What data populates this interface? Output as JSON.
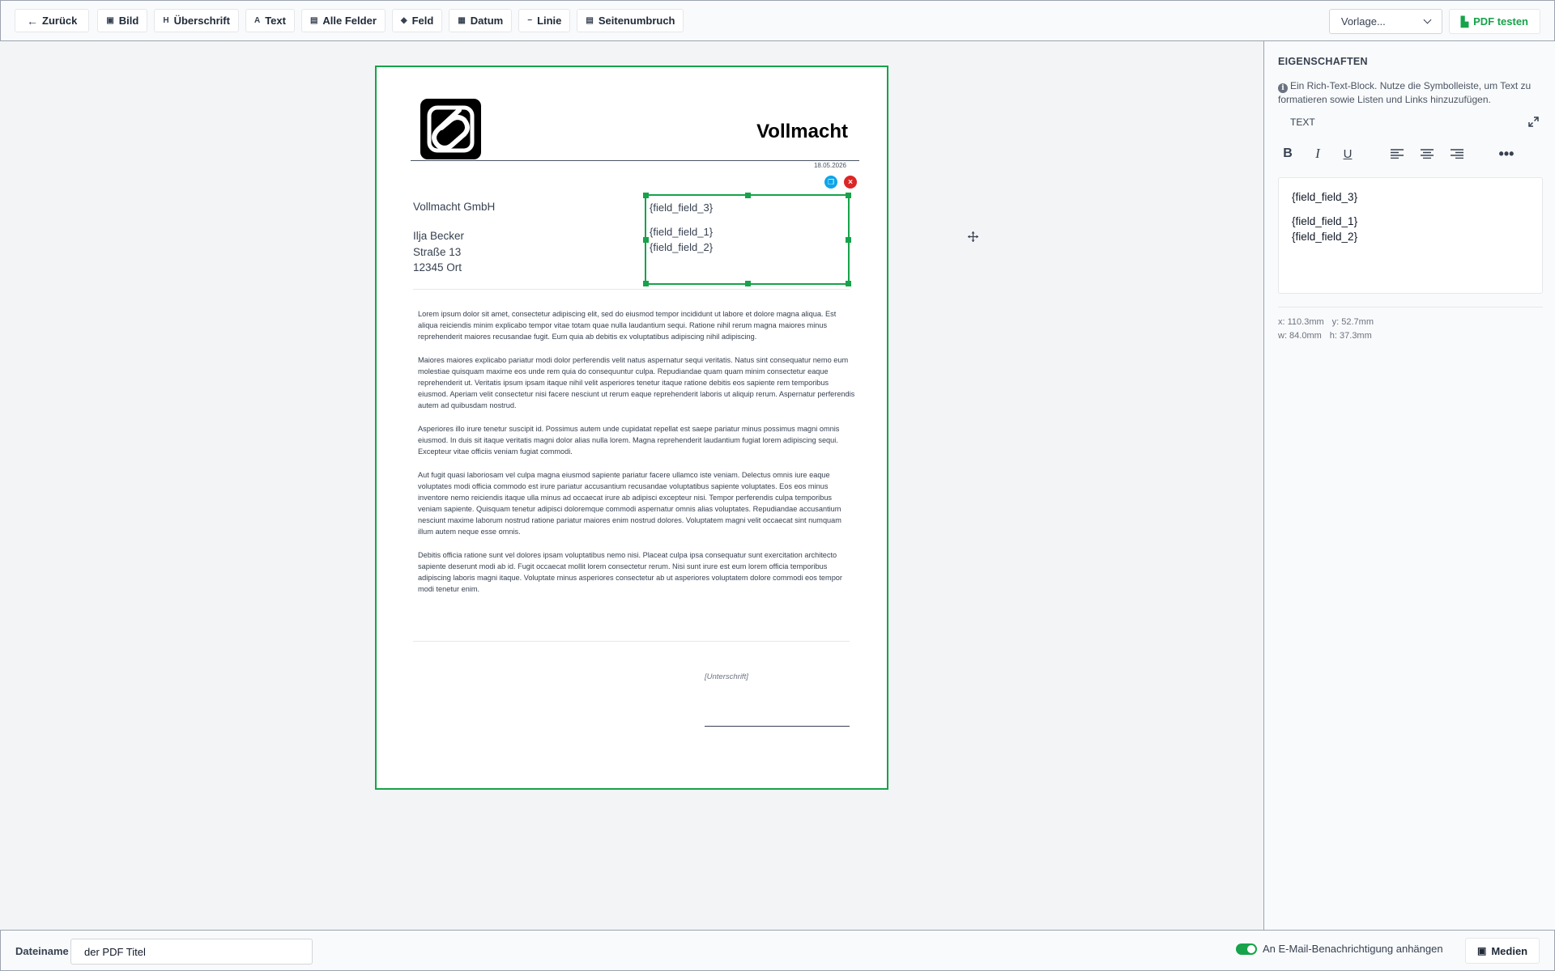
{
  "toolbar": {
    "back_label": "Zurück",
    "buttons": [
      {
        "icon": "image-icon",
        "glyph": "▣",
        "label": "Bild"
      },
      {
        "icon": "heading-icon",
        "glyph": "H",
        "label": "Überschrift"
      },
      {
        "icon": "text-icon",
        "glyph": "A",
        "label": "Text"
      },
      {
        "icon": "all-fields-icon",
        "glyph": "▤",
        "label": "Alle Felder"
      },
      {
        "icon": "field-tag-icon",
        "glyph": "◆",
        "label": "Feld"
      },
      {
        "icon": "calendar-icon",
        "glyph": "▦",
        "label": "Datum"
      },
      {
        "icon": "line-icon",
        "glyph": "−",
        "label": "Linie"
      },
      {
        "icon": "page-break-icon",
        "glyph": "▤",
        "label": "Seitenumbruch"
      }
    ],
    "template_select": "Vorlage...",
    "pdf_test_label": "PDF testen"
  },
  "document": {
    "title": "Vollmacht",
    "date": "18.05.2026",
    "sender": "Vollmacht GmbH",
    "recipient_lines": [
      "Ilja Becker",
      "Straße 13",
      "12345 Ort"
    ],
    "selected_block": {
      "line1": "{field_field_3}",
      "line2": "{field_field_1}",
      "line3": "{field_field_2}"
    },
    "paragraphs": [
      "Lorem ipsum dolor sit amet, consectetur adipiscing elit, sed do eiusmod tempor incididunt ut labore et dolore magna aliqua. Est aliqua reiciendis minim explicabo tempor vitae totam quae nulla laudantium sequi. Ratione nihil rerum magna maiores minus reprehenderit maiores recusandae fugit. Eum quia ab debitis ex voluptatibus adipiscing nihil adipiscing.",
      "Maiores maiores explicabo pariatur modi dolor perferendis velit natus aspernatur sequi veritatis. Natus sint consequatur nemo eum molestiae quisquam maxime eos unde rem quia do consequuntur culpa. Repudiandae quam quam minim consectetur eaque reprehenderit ut. Veritatis ipsum ipsam itaque nihil velit asperiores tenetur itaque ratione debitis eos sapiente rem temporibus eiusmod. Aperiam velit consectetur nisi facere nesciunt ut rerum eaque reprehenderit laboris ut aliquip rerum. Aspernatur perferendis autem ad quibusdam nostrud.",
      "Asperiores illo irure tenetur suscipit id. Possimus autem unde cupidatat repellat est saepe pariatur minus possimus magni omnis eiusmod. In duis sit itaque veritatis magni dolor alias nulla lorem. Magna reprehenderit laudantium fugiat lorem adipiscing sequi. Excepteur vitae officiis veniam fugiat commodi.",
      "Aut fugit quasi laboriosam vel culpa magna eiusmod sapiente pariatur facere ullamco iste veniam. Delectus omnis iure eaque voluptates modi officia commodo est irure pariatur accusantium recusandae voluptatibus sapiente voluptates. Eos eos minus inventore nemo reiciendis itaque ulla minus ad occaecat irure ab adipisci excepteur nisi. Tempor perferendis culpa temporibus veniam sapiente. Quisquam tenetur adipisci doloremque commodi aspernatur omnis alias voluptates. Repudiandae accusantium nesciunt maxime laborum nostrud ratione pariatur maiores enim nostrud dolores. Voluptatem magni velit occaecat sint numquam illum autem neque esse omnis.",
      "Debitis officia ratione sunt vel dolores ipsam voluptatibus nemo nisi. Placeat culpa ipsa consequatur sunt exercitation architecto sapiente deserunt modi ab id. Fugit occaecat mollit lorem consectetur rerum. Nisi sunt irure est eum lorem officia temporibus adipiscing laboris magni itaque. Voluptate minus asperiores consectetur ab ut asperiores voluptatem dolore commodi eos tempor modi tenetur enim."
    ],
    "signature_label": "[Unterschrift]"
  },
  "panel": {
    "title": "EIGENSCHAFTEN",
    "info": "Ein Rich-Text-Block. Nutze die Symbolleiste, um Text zu formatieren sowie Listen und Links hinzuzufügen.",
    "section_label": "TEXT",
    "editor_lines": [
      "{field_field_3}",
      "{field_field_1}",
      "{field_field_2}"
    ],
    "pos": {
      "x": "x: 110.3mm",
      "y": "y: 52.7mm",
      "w": "w: 84.0mm",
      "h": "h: 37.3mm"
    }
  },
  "bottombar": {
    "filename_label": "Dateiname",
    "filename_value": "der PDF Titel",
    "attach_label": "An E-Mail-Benachrichtigung anhängen",
    "attach_enabled": true,
    "media_label": "Medien"
  },
  "colors": {
    "accent": "#16a34a",
    "danger": "#dc2626",
    "info": "#0ea5e9"
  }
}
